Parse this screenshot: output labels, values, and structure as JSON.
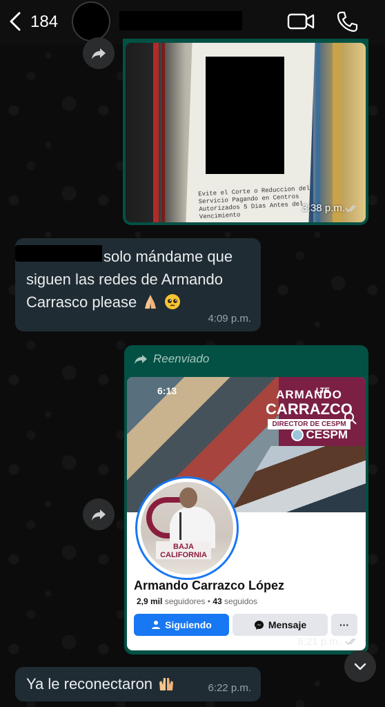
{
  "header": {
    "back_count": "184",
    "contact_name_redacted": true
  },
  "messages": {
    "image_msg": {
      "time": "3:38 p.m.",
      "receipt_text": "Evite el Corte o Reduccion del Servicio Pagando en Centros Autorizados 5 Dias Antes del Vencimiento"
    },
    "text_msg": {
      "text": "solo mándame que siguen las redes de Armando Carrasco please",
      "time": "4:09 p.m."
    },
    "forwarded_msg": {
      "forwarded_label": "Reenviado",
      "time": "6:21 p.m.",
      "screenshot": {
        "status_time": "6:13",
        "status_network": "LTE",
        "cover_line1": "ARMANDO",
        "cover_line2": "CARRAZCO",
        "cover_line3": "DIRECTOR DE CESPM",
        "cover_logo": "CESPM",
        "podium_text": "BAJA CALIFORNIA",
        "profile_name": "Armando Carrazco López",
        "followers_count": "2,9 mil",
        "followers_label": "seguidores",
        "following_count": "43",
        "following_label": "seguidos",
        "follow_button": "Siguiendo",
        "message_button": "Mensaje",
        "more_button": "···"
      }
    },
    "last_msg": {
      "text": "Ya le reconectaron",
      "time": "6:22 p.m."
    }
  },
  "colors": {
    "outgoing_bubble": "#025144",
    "incoming_bubble": "#202c33",
    "facebook_blue": "#1877f2",
    "cover_maroon": "#7b1f45"
  },
  "icons": [
    "chevron-left-icon",
    "video-call-icon",
    "phone-icon",
    "forward-icon",
    "double-check-icon",
    "chevron-down-icon",
    "praying-hands-emoji",
    "pleading-face-emoji",
    "raising-hands-emoji",
    "messenger-icon",
    "search-icon"
  ]
}
